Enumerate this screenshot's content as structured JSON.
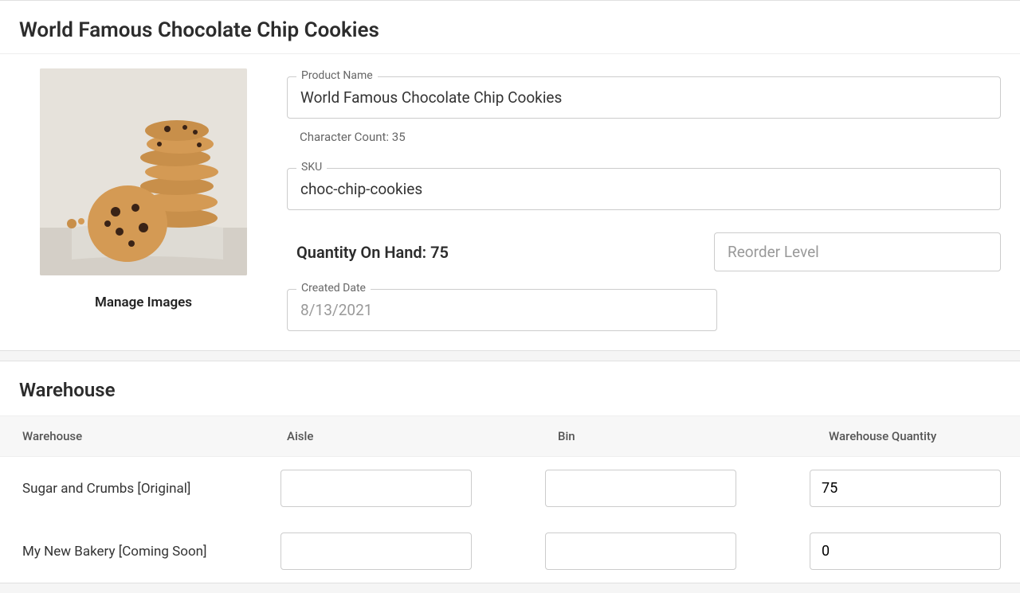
{
  "header": {
    "title": "World Famous Chocolate Chip Cookies"
  },
  "product": {
    "image_alt": "Chocolate chip cookies",
    "manage_images_label": "Manage Images",
    "name_field_label": "Product Name",
    "name_value": "World Famous Chocolate Chip Cookies",
    "char_count_text": "Character Count: 35",
    "sku_field_label": "SKU",
    "sku_value": "choc-chip-cookies",
    "qty_label": "Quantity On Hand: 75",
    "reorder_placeholder": "Reorder Level",
    "created_field_label": "Created Date",
    "created_value": "8/13/2021"
  },
  "warehouse_section": {
    "title": "Warehouse",
    "headers": {
      "name": "Warehouse",
      "aisle": "Aisle",
      "bin": "Bin",
      "qty": "Warehouse Quantity"
    },
    "rows": [
      {
        "name": "Sugar and Crumbs [Original]",
        "aisle": "",
        "bin": "",
        "qty": "75"
      },
      {
        "name": "My New Bakery [Coming Soon]",
        "aisle": "",
        "bin": "",
        "qty": "0"
      }
    ]
  }
}
